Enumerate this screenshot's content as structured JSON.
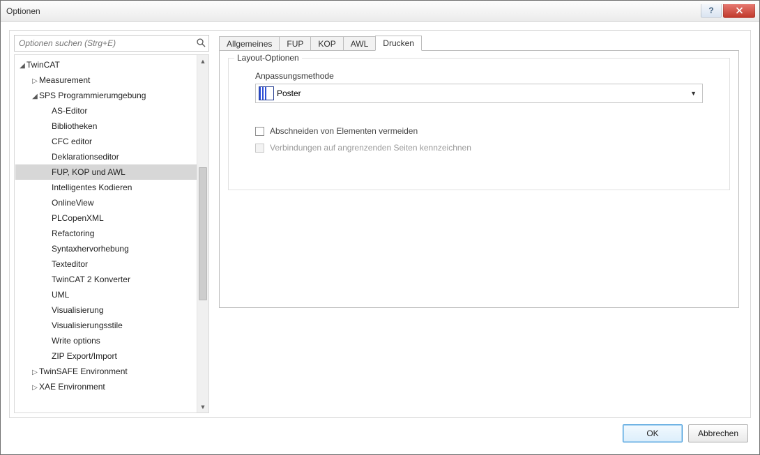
{
  "window": {
    "title": "Optionen"
  },
  "search": {
    "placeholder": "Optionen suchen (Strg+E)"
  },
  "tree": {
    "root": "TwinCAT",
    "measurement": "Measurement",
    "sps": "SPS Programmierumgebung",
    "items": [
      "AS-Editor",
      "Bibliotheken",
      "CFC editor",
      "Deklarationseditor",
      "FUP, KOP und AWL",
      "Intelligentes Kodieren",
      "OnlineView",
      "PLCopenXML",
      "Refactoring",
      "Syntaxhervorhebung",
      "Texteditor",
      "TwinCAT 2 Konverter",
      "UML",
      "Visualisierung",
      "Visualisierungsstile",
      "Write options",
      "ZIP Export/Import"
    ],
    "twinsafe": "TwinSAFE Environment",
    "xae": "XAE Environment"
  },
  "tabs": {
    "t0": "Allgemeines",
    "t1": "FUP",
    "t2": "KOP",
    "t3": "AWL",
    "t4": "Drucken"
  },
  "layout": {
    "legend": "Layout-Optionen",
    "methodLabel": "Anpassungsmethode",
    "methodValue": "Poster",
    "chk1": "Abschneiden von Elementen vermeiden",
    "chk2": "Verbindungen auf angrenzenden Seiten kennzeichnen"
  },
  "buttons": {
    "ok": "OK",
    "cancel": "Abbrechen"
  }
}
